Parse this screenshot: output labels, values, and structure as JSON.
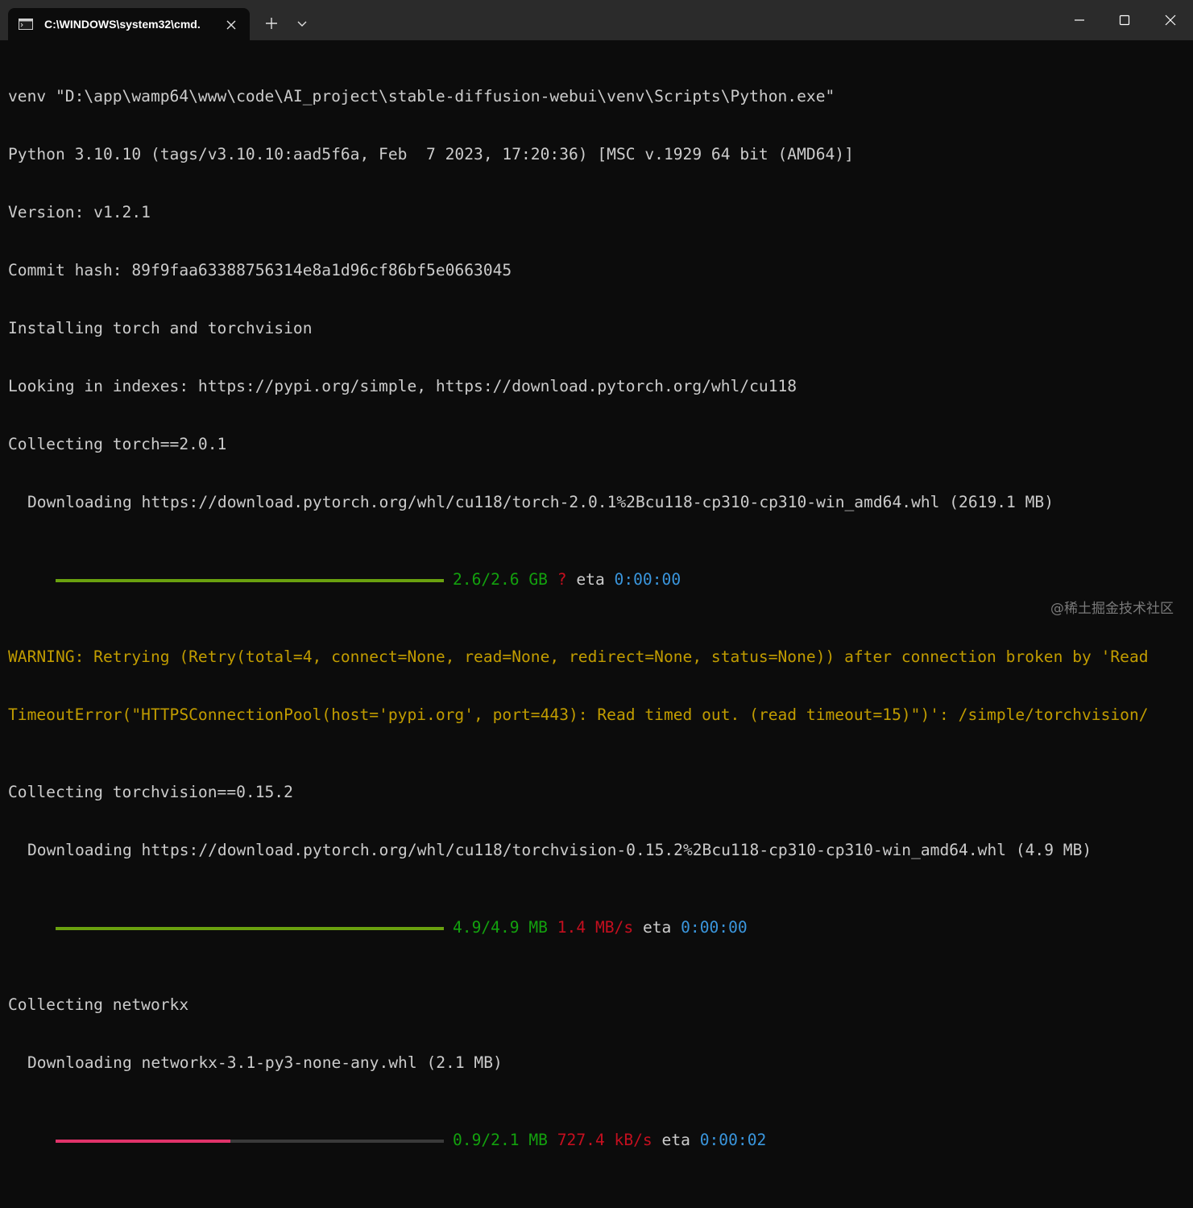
{
  "window": {
    "tab_title": "C:\\WINDOWS\\system32\\cmd.",
    "icons": {
      "tab": "cmd-icon",
      "close_tab": "close-icon",
      "new_tab": "plus-icon",
      "dropdown": "chevron-down-icon",
      "minimize": "minimize-icon",
      "maximize": "maximize-icon",
      "close": "close-icon"
    }
  },
  "terminal": {
    "lines": [
      "venv \"D:\\app\\wamp64\\www\\code\\AI_project\\stable-diffusion-webui\\venv\\Scripts\\Python.exe\"",
      "Python 3.10.10 (tags/v3.10.10:aad5f6a, Feb  7 2023, 17:20:36) [MSC v.1929 64 bit (AMD64)]",
      "Version: v1.2.1",
      "Commit hash: 89f9faa63388756314e8a1d96cf86bf5e0663045",
      "Installing torch and torchvision",
      "Looking in indexes: https://pypi.org/simple, https://download.pytorch.org/whl/cu118",
      "Collecting torch==2.0.1",
      "Downloading https://download.pytorch.org/whl/cu118/torch-2.0.1%2Bcu118-cp310-cp310-win_amd64.whl (2619.1 MB)"
    ],
    "progress1": {
      "size": "2.6/2.6 GB",
      "speed": "?",
      "eta_label": "eta",
      "eta": "0:00:00",
      "fraction": 1.0,
      "bar_color": "#6aa10f"
    },
    "warning": [
      "WARNING: Retrying (Retry(total=4, connect=None, read=None, redirect=None, status=None)) after connection broken by 'Read",
      "TimeoutError(\"HTTPSConnectionPool(host='pypi.org', port=443): Read timed out. (read timeout=15)\")': /simple/torchvision/"
    ],
    "lines2": [
      "Collecting torchvision==0.15.2",
      "Downloading https://download.pytorch.org/whl/cu118/torchvision-0.15.2%2Bcu118-cp310-cp310-win_amd64.whl (4.9 MB)"
    ],
    "progress2": {
      "size": "4.9/4.9 MB",
      "speed": "1.4 MB/s",
      "eta_label": "eta",
      "eta": "0:00:00",
      "fraction": 1.0,
      "bar_color": "#6aa10f"
    },
    "lines3": [
      "Collecting networkx",
      "Downloading networkx-3.1-py3-none-any.whl (2.1 MB)"
    ],
    "progress3": {
      "size": "0.9/2.1 MB",
      "speed": "727.4 kB/s",
      "eta_label": "eta",
      "eta": "0:00:02",
      "fraction": 0.45,
      "bar_color": "#e0336a"
    }
  },
  "watermark": "@稀土掘金技术社区"
}
